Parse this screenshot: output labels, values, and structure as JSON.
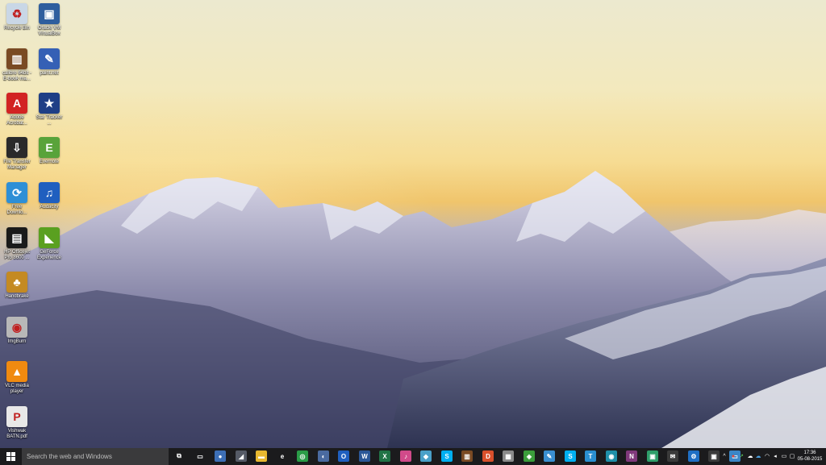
{
  "desktop_icons": [
    {
      "name": "recycle-bin-icon",
      "label": "Recycle Bin",
      "color": "#c9d7e6",
      "glyph": "♻"
    },
    {
      "name": "virtualbox-icon",
      "label": "Oracle VM VirtualBox",
      "color": "#2f5e9e",
      "glyph": "▣"
    },
    {
      "name": "calibre-icon",
      "label": "calibre 64bit - E-book ma...",
      "color": "#7a4a23",
      "glyph": "▥"
    },
    {
      "name": "paint-net-icon",
      "label": "paint.net",
      "color": "#3560b5",
      "glyph": "✎"
    },
    {
      "name": "adobe-reader-icon",
      "label": "Adobe Acrobat...",
      "color": "#d22323",
      "glyph": "A"
    },
    {
      "name": "star-tracker-icon",
      "label": "Star Tracker ...",
      "color": "#1f3f86",
      "glyph": "★"
    },
    {
      "name": "file-transfer-manager-icon",
      "label": "File Transfer Manager",
      "color": "#2a2a2a",
      "glyph": "⇩"
    },
    {
      "name": "evernote-icon",
      "label": "Evernote",
      "color": "#59a33a",
      "glyph": "E"
    },
    {
      "name": "free-download-manager-icon",
      "label": "Free Downlo...",
      "color": "#2e8fd6",
      "glyph": "⟳"
    },
    {
      "name": "audacity-icon",
      "label": "Audacity",
      "color": "#1f5fbf",
      "glyph": "♫"
    },
    {
      "name": "hp-officejet-icon",
      "label": "HP Officejet Pro 8600 ...",
      "color": "#1a1a1a",
      "glyph": "▤"
    },
    {
      "name": "geforce-experience-icon",
      "label": "GeForce Experience",
      "color": "#5aa020",
      "glyph": "◣"
    },
    {
      "name": "handbrake-icon",
      "label": "Handbrake",
      "color": "#c48a22",
      "glyph": "♣"
    },
    {
      "name": "imgburn-icon",
      "label": "ImgBurn",
      "color": "#b8b8b8",
      "glyph": "◉"
    },
    {
      "name": "vlc-icon",
      "label": "VLC media player",
      "color": "#f08a10",
      "glyph": "▲"
    },
    {
      "name": "pdf-file-icon",
      "label": "Vishwak BATN.pdf",
      "color": "#e8e8e8",
      "glyph": "P"
    }
  ],
  "taskbar": {
    "search_placeholder": "Search the web and Windows",
    "pinned": [
      {
        "name": "task-view-icon",
        "glyph": "⧉",
        "color": "#1b1b1d"
      },
      {
        "name": "cmd-icon",
        "glyph": "▭",
        "color": "#1b1b1d"
      },
      {
        "name": "chrome-app-icon",
        "glyph": "●",
        "color": "#3d6fb6"
      },
      {
        "name": "ssh-client-icon",
        "glyph": "◢",
        "color": "#555a66"
      },
      {
        "name": "file-explorer-icon",
        "glyph": "▬",
        "color": "#e8b830"
      },
      {
        "name": "edge-icon",
        "glyph": "e",
        "color": "#1b1b1d"
      },
      {
        "name": "chrome-icon",
        "glyph": "◎",
        "color": "#2a9c47"
      },
      {
        "name": "utility-icon",
        "glyph": "◐",
        "color": "#4a6aa0"
      },
      {
        "name": "outlook-icon",
        "glyph": "O",
        "color": "#1f5fbf"
      },
      {
        "name": "word-icon",
        "glyph": "W",
        "color": "#2b5797"
      },
      {
        "name": "excel-icon",
        "glyph": "X",
        "color": "#217346"
      },
      {
        "name": "itunes-icon",
        "glyph": "♪",
        "color": "#d14a8a"
      },
      {
        "name": "notes-icon",
        "glyph": "◆",
        "color": "#4aa0c8"
      },
      {
        "name": "skype-icon",
        "glyph": "S",
        "color": "#00aff0"
      },
      {
        "name": "calibre-app-icon",
        "glyph": "▥",
        "color": "#7a4a23"
      },
      {
        "name": "dashlane-icon",
        "glyph": "D",
        "color": "#d9502b"
      },
      {
        "name": "evernote-app-icon",
        "glyph": "▦",
        "color": "#8a8a8a"
      },
      {
        "name": "camtasia-icon",
        "glyph": "◈",
        "color": "#3b9d3b"
      },
      {
        "name": "edit-icon",
        "glyph": "✎",
        "color": "#3a8fd0"
      },
      {
        "name": "skype-app-icon",
        "glyph": "S",
        "color": "#00aff0"
      },
      {
        "name": "tweetdeck-icon",
        "glyph": "T",
        "color": "#2a8fcf"
      },
      {
        "name": "vpn-icon",
        "glyph": "◉",
        "color": "#1f8fa8"
      },
      {
        "name": "onenote-icon",
        "glyph": "N",
        "color": "#80397b"
      },
      {
        "name": "money-icon",
        "glyph": "▣",
        "color": "#2f9e6a"
      },
      {
        "name": "mail-icon",
        "glyph": "✉",
        "color": "#3a3a3a"
      },
      {
        "name": "settings-icon",
        "glyph": "⚙",
        "color": "#1f6fc4"
      },
      {
        "name": "virtualbox-app-icon",
        "glyph": "▣",
        "color": "#3a3a3a"
      },
      {
        "name": "remote-desktop-icon",
        "glyph": "▭",
        "color": "#3a86c6"
      }
    ],
    "tray": [
      {
        "name": "show-hidden-icons-chevron-icon",
        "glyph": "^",
        "color": "#ffffff"
      },
      {
        "name": "red-circle-tray-icon",
        "glyph": "●",
        "color": "#e0463a"
      },
      {
        "name": "arrow-tray-icon",
        "glyph": "↗",
        "color": "#5cc05c"
      },
      {
        "name": "onedrive-icon",
        "glyph": "☁",
        "color": "#ffffff"
      },
      {
        "name": "cloud-tray-icon",
        "glyph": "☁",
        "color": "#4aa0e0"
      },
      {
        "name": "network-icon",
        "glyph": "◠",
        "color": "#ffffff"
      },
      {
        "name": "volume-icon",
        "glyph": "◂",
        "color": "#ffffff"
      },
      {
        "name": "input-indicator-icon",
        "glyph": "▭",
        "color": "#ffffff"
      },
      {
        "name": "action-center-icon",
        "glyph": "▢",
        "color": "#ffffff"
      }
    ],
    "clock": {
      "time": "17:36",
      "date": "05-08-2015"
    }
  }
}
